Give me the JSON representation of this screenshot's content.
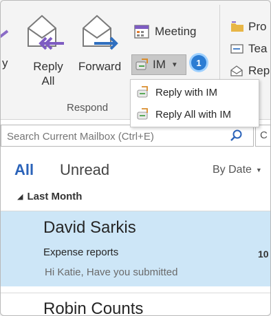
{
  "ribbon": {
    "reply_partial": "y",
    "reply_all_line1": "Reply",
    "reply_all_line2": "All",
    "forward": "Forward",
    "meeting": "Meeting",
    "im": "IM",
    "group_label": "Respond",
    "right_items": [
      "Pro",
      "Tea",
      "Rep"
    ]
  },
  "dropdown": {
    "items": [
      "Reply with IM",
      "Reply All with IM"
    ]
  },
  "badge": "1",
  "search": {
    "placeholder": "Search Current Mailbox (Ctrl+E)",
    "side_text": "C"
  },
  "filters": {
    "all": "All",
    "unread": "Unread",
    "sort": "By Date"
  },
  "group": {
    "label": "Last Month"
  },
  "messages": [
    {
      "sender": "David Sarkis",
      "subject": "Expense reports",
      "time": "10",
      "preview": "Hi Katie, Have you submitted"
    },
    {
      "sender": "Robin Counts"
    }
  ],
  "colors": {
    "accent": "#2b63b9",
    "selected_row": "#cde6f7",
    "badge": "#2b7cd3",
    "ribbon_bg": "#f4f4f4"
  }
}
